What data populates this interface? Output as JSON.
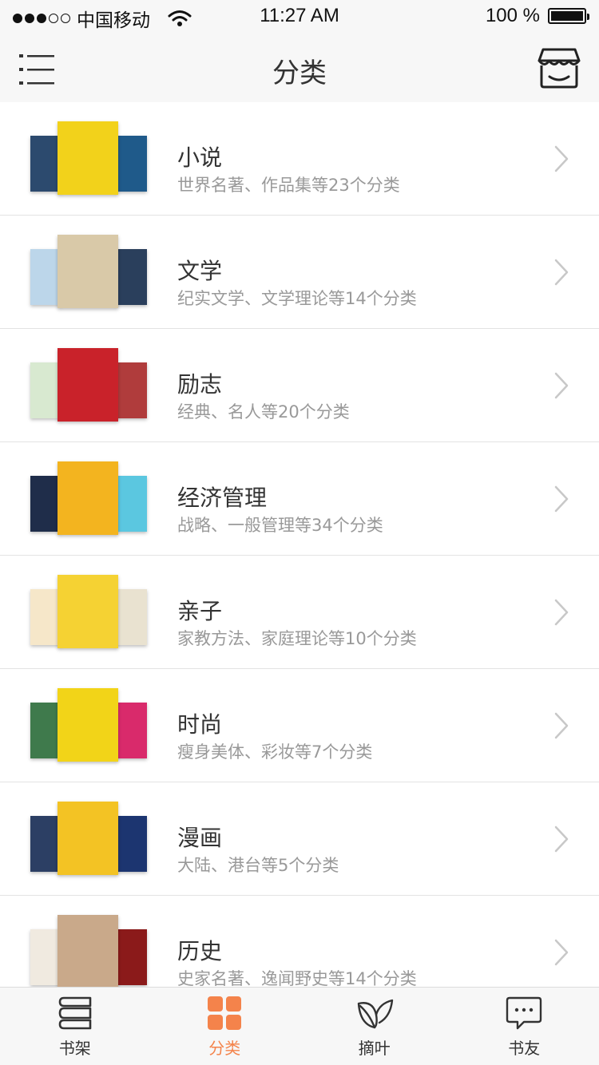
{
  "status_bar": {
    "carrier": "中国移动",
    "time": "11:27 AM",
    "battery": "100 %"
  },
  "nav": {
    "title": "分类",
    "menu_icon": "menu-list-icon",
    "store_icon": "store-icon"
  },
  "categories": [
    {
      "title": "小说",
      "subtitle": "世界名著、作品集等23个分类",
      "covers": [
        "#2c4a6e",
        "#f2d21b",
        "#1f5a8a"
      ]
    },
    {
      "title": "文学",
      "subtitle": "纪实文学、文学理论等14个分类",
      "covers": [
        "#bcd6ea",
        "#d9c9a8",
        "#2a3f5c"
      ]
    },
    {
      "title": "励志",
      "subtitle": "经典、名人等20个分类",
      "covers": [
        "#d8e9d0",
        "#c9222a",
        "#b03c3c"
      ]
    },
    {
      "title": "经济管理",
      "subtitle": "战略、一般管理等34个分类",
      "covers": [
        "#1f2d4a",
        "#f3b41f",
        "#5bc7e0"
      ]
    },
    {
      "title": "亲子",
      "subtitle": "家教方法、家庭理论等10个分类",
      "covers": [
        "#f6e7c9",
        "#f5d233",
        "#e9e2d0"
      ]
    },
    {
      "title": "时尚",
      "subtitle": "瘦身美体、彩妆等7个分类",
      "covers": [
        "#3f7a4c",
        "#f2d418",
        "#d92a6b"
      ]
    },
    {
      "title": "漫画",
      "subtitle": "大陆、港台等5个分类",
      "covers": [
        "#2c3f64",
        "#f3c324",
        "#1c3570"
      ]
    },
    {
      "title": "历史",
      "subtitle": "史家名著、逸闻野史等14个分类",
      "covers": [
        "#f0eae0",
        "#c9a98a",
        "#8b1a1a"
      ]
    }
  ],
  "tabs": [
    {
      "label": "书架",
      "icon": "bookshelf-icon",
      "active": false
    },
    {
      "label": "分类",
      "icon": "category-grid-icon",
      "active": true
    },
    {
      "label": "摘叶",
      "icon": "leaf-icon",
      "active": false
    },
    {
      "label": "书友",
      "icon": "chat-bubble-icon",
      "active": false
    }
  ],
  "colors": {
    "accent": "#f4834b",
    "bar_bg": "#f7f7f7",
    "subtitle": "#999999"
  }
}
